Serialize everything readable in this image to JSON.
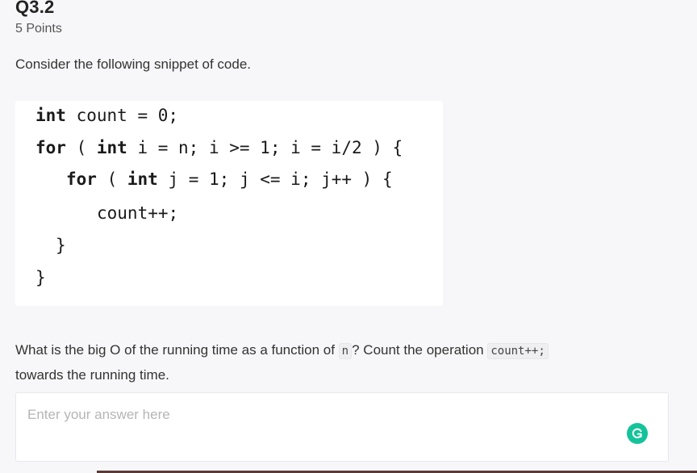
{
  "question": {
    "title": "Q3.2",
    "points": "5 Points",
    "intro": "Consider the following snippet of code."
  },
  "code": {
    "lines": [
      {
        "kw": "int",
        "rest": " count = 0;"
      },
      {
        "kw": "for",
        "rest": " ( ",
        "kw2": "int",
        "rest2": " i = n; i >= 1; i = i/2 ) {"
      },
      {
        "kw": "for",
        "rest": " ( ",
        "kw2": "int",
        "rest2": " j = 1; j <= i; j++ ) {"
      },
      {
        "text": "count++;"
      },
      {
        "text": "}"
      },
      {
        "text": "}"
      }
    ]
  },
  "prompt": {
    "part1": "What is the big O of the running time as a function of ",
    "code1": "n",
    "part2": "? Count the operation ",
    "code2": "count++;",
    "part3": " towards the running time."
  },
  "answer": {
    "placeholder": "Enter your answer here",
    "value": ""
  },
  "icons": {
    "grammarly": "grammarly-icon",
    "grammarly_color": "#15c39a"
  }
}
